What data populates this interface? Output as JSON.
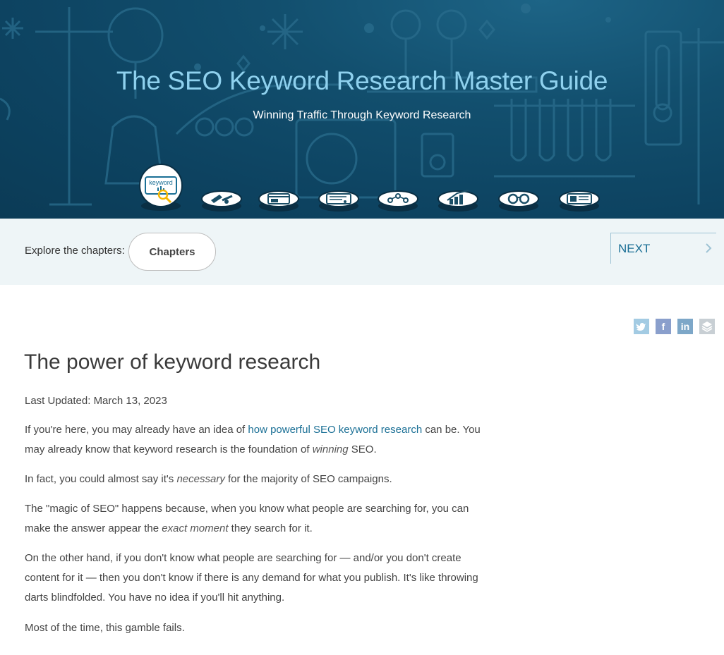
{
  "hero": {
    "title": "The SEO Keyword Research Master Guide",
    "subtitle": "Winning Traffic Through Keyword Research",
    "active_chapter_label": "keyword",
    "colors": {
      "bg": "#0d4361",
      "title": "#8fd1ee",
      "accent": "#f5b700"
    }
  },
  "chapter_icons": [
    {
      "icon": "keyword-magnifier-icon",
      "active": true
    },
    {
      "icon": "tools-icon",
      "active": false
    },
    {
      "icon": "browser-window-icon",
      "active": false
    },
    {
      "icon": "list-panel-icon",
      "active": false
    },
    {
      "icon": "network-nodes-icon",
      "active": false
    },
    {
      "icon": "bar-chart-icon",
      "active": false
    },
    {
      "icon": "binoculars-icon",
      "active": false
    },
    {
      "icon": "document-icon",
      "active": false
    }
  ],
  "nav": {
    "explore_label": "Explore the chapters:",
    "chapters_button": "Chapters",
    "next_label": "NEXT"
  },
  "social": [
    {
      "name": "twitter",
      "icon": "twitter-icon",
      "color": "#a3cbe3"
    },
    {
      "name": "facebook",
      "icon": "facebook-icon",
      "glyph": "f",
      "color": "#8a9fcc"
    },
    {
      "name": "linkedin",
      "icon": "linkedin-icon",
      "glyph": "in",
      "color": "#7da7c8"
    },
    {
      "name": "buffer",
      "icon": "buffer-icon",
      "color": "#c8cfd4"
    }
  ],
  "article": {
    "title": "The power of keyword research",
    "updated": "Last Updated: March 13, 2023",
    "p1_a": "If you're here, you may already have an idea of ",
    "p1_link": "how powerful SEO keyword research",
    "p1_b": " can be. You may already know that keyword research is the foundation of ",
    "p1_em": "winning",
    "p1_c": " SEO.",
    "p2_a": "In fact, you could almost say it's ",
    "p2_em": "necessary",
    "p2_b": " for the majority of SEO campaigns.",
    "p3_a": "The \"magic of SEO\" happens because, when you know what people are searching for, you can make the answer appear the ",
    "p3_em": "exact moment",
    "p3_b": " they search for it.",
    "p4": "On the other hand, if you don't know what people are searching for — and/or you don't create content for it — then you don't know if there is any demand for what you publish. It's like throwing darts blindfolded. You have no idea if you'll hit anything.",
    "p5": "Most of the time, this gamble fails."
  }
}
